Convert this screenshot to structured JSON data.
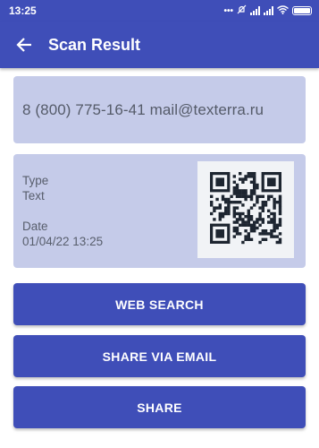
{
  "status_bar": {
    "time": "13:25",
    "icons": [
      "more-dots-icon",
      "mute-icon",
      "signal-icon",
      "signal-icon",
      "wifi-icon",
      "battery-icon"
    ]
  },
  "app_bar": {
    "title": "Scan Result",
    "back_icon": "arrow-left-icon"
  },
  "result": {
    "content": "8 (800) 775-16-41 mail@texterra.ru",
    "type_label": "Type",
    "type_value": "Text",
    "date_label": "Date",
    "date_value": "01/04/22 13:25"
  },
  "buttons": {
    "web_search": "WEB SEARCH",
    "share_email": "SHARE VIA EMAIL",
    "share": "SHARE"
  },
  "colors": {
    "primary": "#3f4eb8",
    "card": "#c5cbe9",
    "text_muted": "#585e6c"
  }
}
